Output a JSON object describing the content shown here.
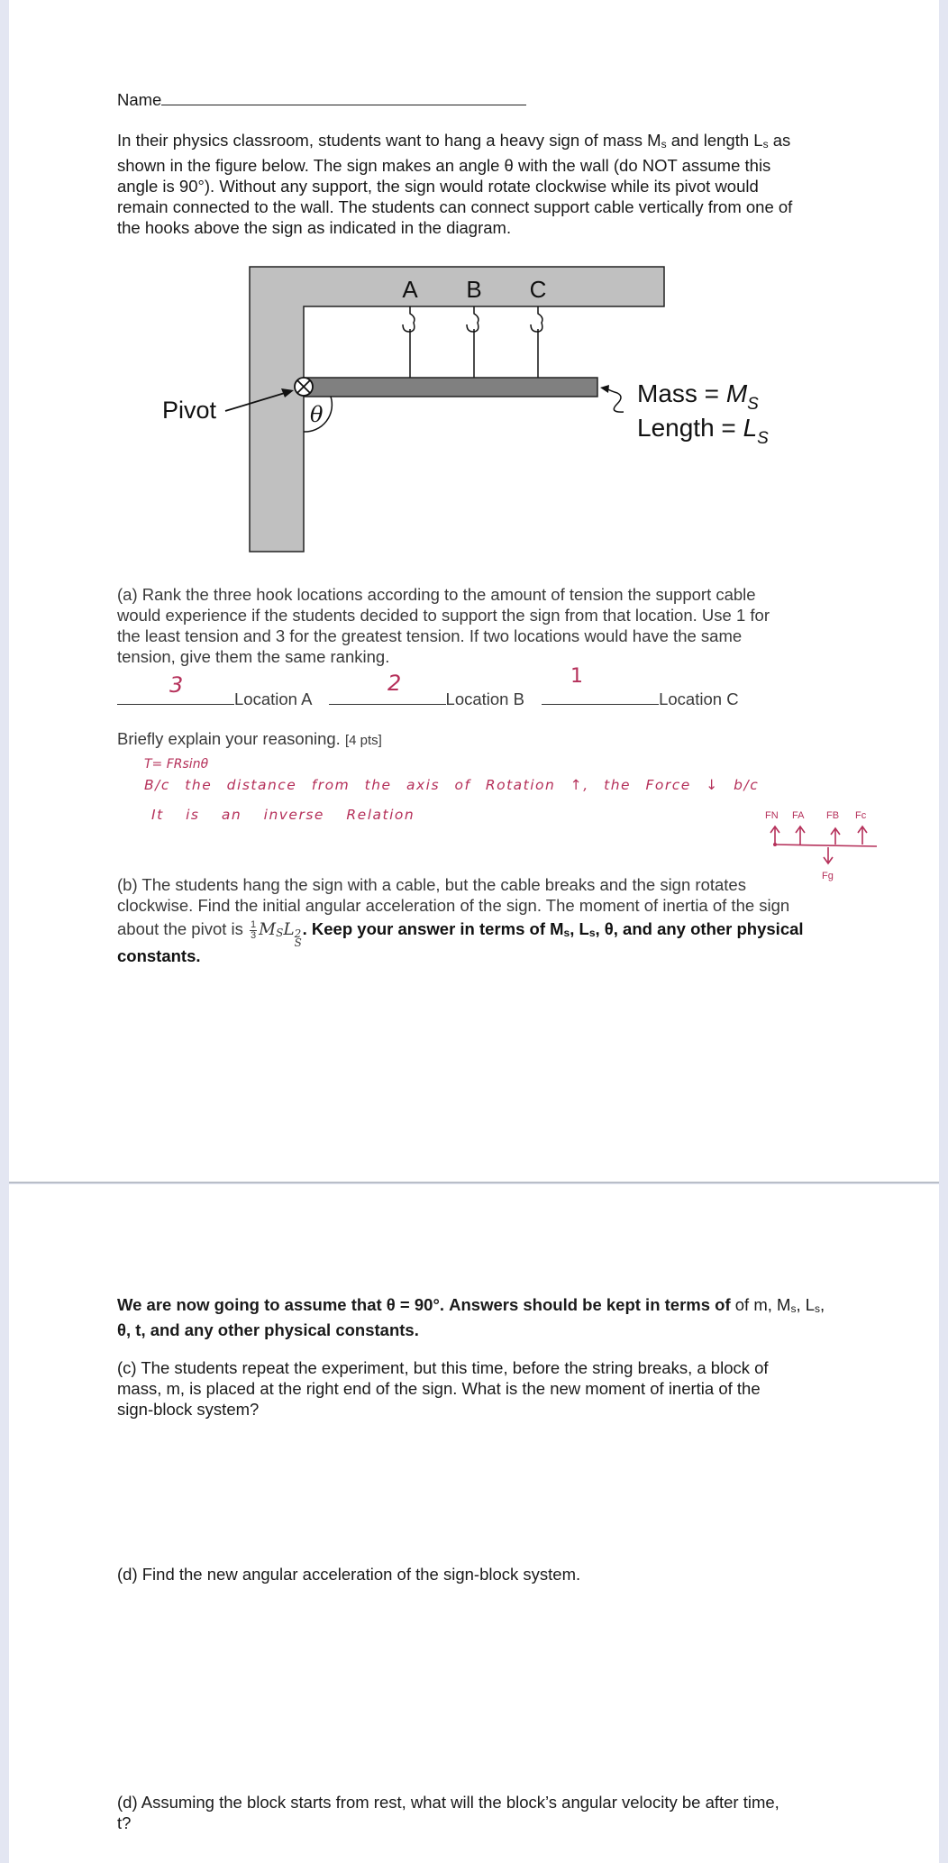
{
  "header": {
    "name_label": "Name"
  },
  "intro": {
    "line1": "In their physics classroom, students want to hang a heavy sign of mass M",
    "line1_sub": "s",
    "line1_mid": " and length L",
    "line1_sub2": "s",
    "line1_end": " as",
    "line2": "shown in the figure below. The sign makes an angle θ with the wall (do NOT assume this",
    "line3": "angle is 90°). Without any support, the sign would rotate clockwise while its pivot would",
    "line4": "remain connected to the wall. The students can connect support cable vertically from one of",
    "line5": "the hooks above the sign as indicated in the diagram."
  },
  "diagram": {
    "hook_labels": [
      "A",
      "B",
      "C"
    ],
    "pivot_label": "Pivot",
    "angle_label": "θ",
    "mass_label": "Mass = ",
    "mass_symbol": "M",
    "mass_sub": "S",
    "length_label": "Length = ",
    "length_symbol": "L",
    "length_sub": "S",
    "colors": {
      "wall": "#c0c0c0",
      "sign": "#808080"
    }
  },
  "part_a": {
    "line1": "(a) Rank the three hook locations according to the amount of tension the support cable",
    "line2": "would experience if the students decided to support the sign from that location. Use 1 for",
    "line3": "the least tension and 3 for the greatest tension. If two locations would have the same",
    "line4": "tension, give them the same ranking.",
    "locations": [
      {
        "label": "Location A",
        "answer": "3"
      },
      {
        "label": "Location B",
        "answer": "2"
      },
      {
        "label": "Location C",
        "answer": "1"
      }
    ],
    "explain_prompt": "Briefly explain your reasoning.",
    "points": "[4 pts]",
    "handwritten": {
      "line1": "T= FRsinθ",
      "line2": "B/c the distance from the axis of Rotation ↑, the Force ↓ b/c",
      "line3": "It is an inverse Relation",
      "fbd_labels": [
        "FN",
        "FA",
        "FB",
        "Fc"
      ],
      "fbd_down_label": "Fg",
      "ink_color": "#b5305a"
    }
  },
  "part_b": {
    "line1": "(b) The students hang the sign with a cable, but the cable breaks and the sign rotates",
    "line2": "clockwise. Find the initial angular acceleration of the sign. The moment of inertia of the sign",
    "line3_start": "about the pivot is ",
    "frac_num": "1",
    "frac_den": "3",
    "inertia_expr_M": "M",
    "inertia_expr_Msub": "S",
    "inertia_expr_L": "L",
    "inertia_expr_Lsup": "2",
    "inertia_expr_Lsub": "S",
    "line3_bold": ". Keep your answer in terms of M",
    "line3_sub1": "s",
    "line3_bold2": ", L",
    "line3_sub2": "s",
    "line3_bold3": ", θ, and any other physical",
    "line4": "constants."
  },
  "assumption": {
    "line1_bold": "We are now going to assume that θ = 90°. Answers should be kept in terms of",
    "line1_plain": " of m, M",
    "line1_sub1": "s",
    "line1_mid": ", L",
    "line1_sub2": "s",
    "line1_end": ",",
    "line2": "θ, t, and any other physical constants."
  },
  "part_c": {
    "line1": "(c) The students repeat the experiment, but this time, before the string breaks, a block of",
    "line2": "mass, m, is placed at the right end of the sign. What is the new moment of inertia of the",
    "line3": "sign-block system?"
  },
  "part_d1": {
    "line1": "(d) Find the new angular acceleration of the sign-block system."
  },
  "part_d2": {
    "line1": "(d) Assuming the block starts from rest, what will the block’s angular velocity be after time,",
    "line2": "t?"
  }
}
